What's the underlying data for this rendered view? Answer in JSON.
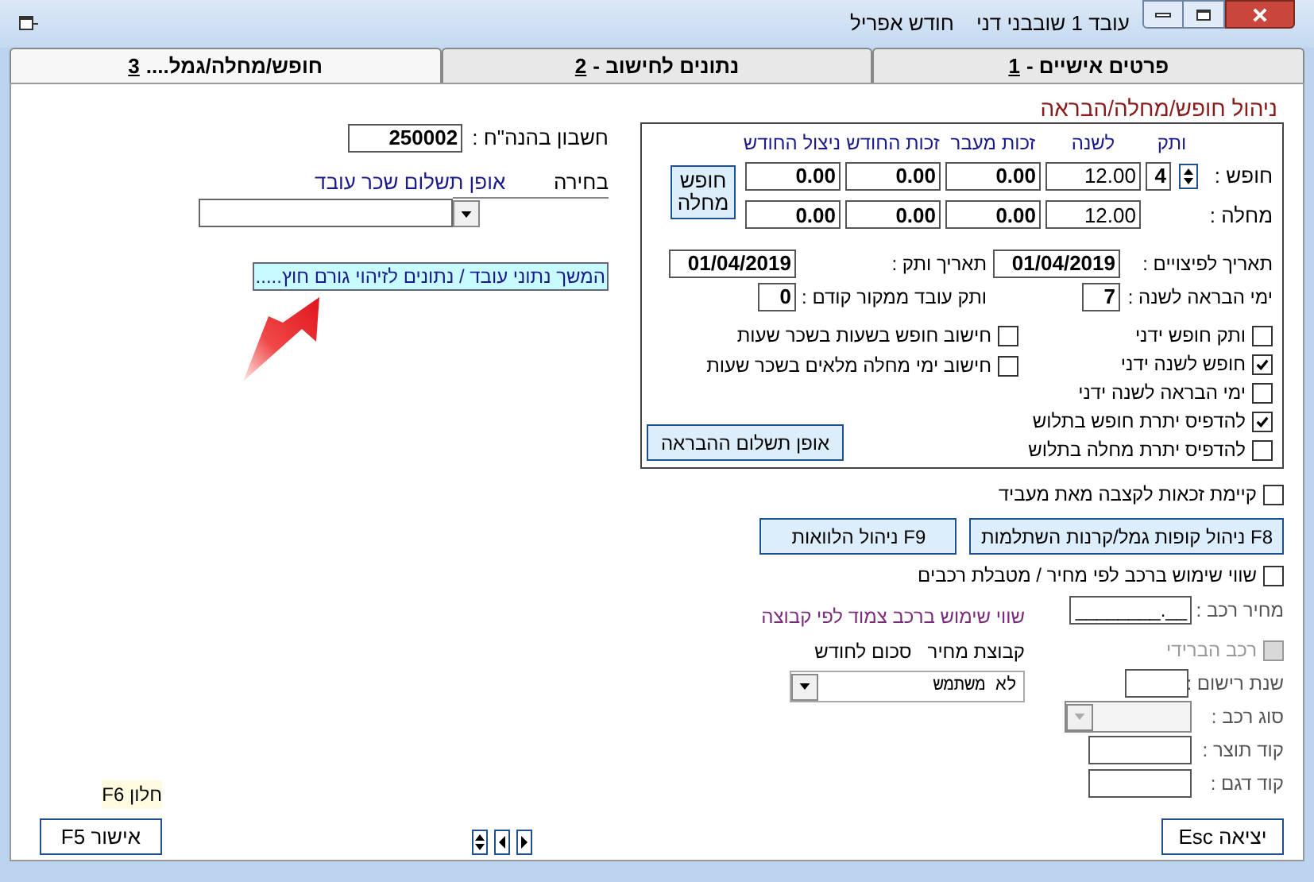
{
  "window": {
    "title_parts": [
      "עובד 1 שובבני דני",
      "חודש אפריל"
    ]
  },
  "tabs": [
    {
      "label": "פרטים אישיים -",
      "hotkey": "1",
      "selected": false
    },
    {
      "label": "נתונים לחישוב -",
      "hotkey": "2",
      "selected": false
    },
    {
      "label": "חופש/מחלה/גמל....",
      "hotkey": "3",
      "selected": true
    }
  ],
  "leave": {
    "title": "ניהול חופש/מחלה/הבראה",
    "columns": [
      "ותק",
      "לשנה",
      "זכות מעבר",
      "זכות החודש",
      "ניצול החודש"
    ],
    "rows": [
      {
        "label": "חופש :",
        "seniority": "4",
        "values": [
          "12.00",
          "0.00",
          "0.00",
          "0.00"
        ]
      },
      {
        "label": "מחלה :",
        "values": [
          "12.00",
          "0.00",
          "0.00",
          "0.00"
        ]
      }
    ],
    "sick_button": "חופש מחלה",
    "dates": [
      {
        "label": "תאריך לפיצויים :",
        "value": "01/04/2019"
      },
      {
        "label": "תאריך ותק :",
        "value": "01/04/2019"
      },
      {
        "label": "ימי הבראה לשנה :",
        "value": "7"
      },
      {
        "label": "ותק עובד ממקור קודם :",
        "value": "0"
      }
    ],
    "checks_right": [
      {
        "label": "ותק חופש ידני",
        "checked": false
      },
      {
        "label": "חופש לשנה ידני",
        "checked": true
      },
      {
        "label": "ימי הבראה לשנה ידני",
        "checked": false
      },
      {
        "label": "להדפיס יתרת חופש בתלוש",
        "checked": true
      },
      {
        "label": "להדפיס יתרת מחלה בתלוש",
        "checked": false
      }
    ],
    "checks_left": [
      {
        "label": "חישוב חופש בשעות בשכר שעות",
        "checked": false
      },
      {
        "label": "חישוב ימי מחלה מלאים בשכר שעות",
        "checked": false
      }
    ],
    "recuperation_button": "אופן תשלום ההבראה"
  },
  "pension": {
    "label": "קיימת זכאות לקצבה מאת מעביד",
    "checked": false
  },
  "action_buttons": [
    "F8 ניהול קופות גמל/קרנות השתלמות",
    "F9 ניהול הלוואות"
  ],
  "car": {
    "checkbox": {
      "label": "שווי שימוש ברכב לפי מחיר / מטבלת רכבים",
      "checked": false
    },
    "price": {
      "label": "מחיר רכב :",
      "value": "________.__"
    },
    "hybrid": {
      "label": "רכב הברידי",
      "checked": false,
      "disabled": true
    },
    "registration_year": {
      "label": "שנת רישום :"
    },
    "car_type": {
      "label": "סוג רכב :",
      "disabled": true
    },
    "manufacturer_code": {
      "label": "קוד תוצר :"
    },
    "model_code": {
      "label": "קוד דגם :"
    },
    "group_title": "שווי שימוש ברכב צמוד לפי קבוצה",
    "group_columns": [
      "קבוצת מחיר",
      "סכום לחודש"
    ],
    "group_value": "לא משתמש"
  },
  "account": {
    "label": "חשבון בהנה\"ח :",
    "value": "250002"
  },
  "payment": {
    "labels": [
      "בחירה",
      "אופן תשלום שכר עובד"
    ]
  },
  "continue_link": "המשך נתוני עובד / נתונים לזיהוי גורם חוץ.....",
  "f6_label": "חלון F6",
  "ok_button": "אישור F5",
  "exit_button": "יציאה Esc"
}
